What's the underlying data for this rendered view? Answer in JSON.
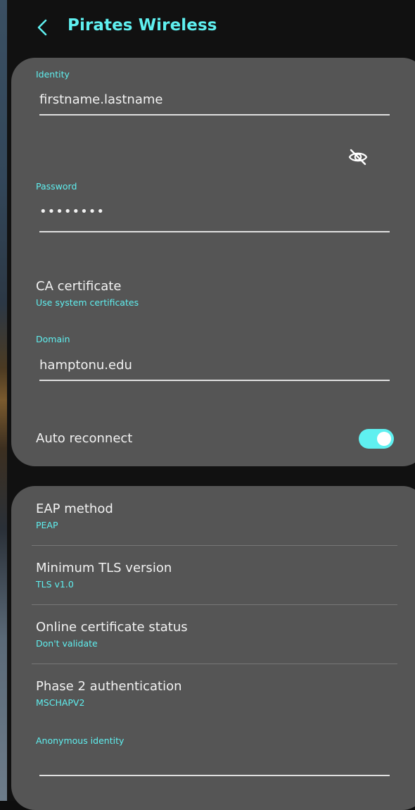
{
  "header": {
    "title": "Pirates Wireless",
    "back_icon": "chevron-left-icon"
  },
  "form": {
    "identity": {
      "label": "Identity",
      "value": "firstname.lastname"
    },
    "password": {
      "label": "Password",
      "value": "••••••••",
      "visibility_icon": "eye-off-icon"
    },
    "ca_certificate": {
      "title": "CA certificate",
      "value": "Use system certificates"
    },
    "domain": {
      "label": "Domain",
      "value": "hamptonu.edu"
    },
    "auto_reconnect": {
      "label": "Auto reconnect",
      "enabled": true
    }
  },
  "advanced": {
    "eap_method": {
      "title": "EAP method",
      "value": "PEAP"
    },
    "min_tls": {
      "title": "Minimum TLS version",
      "value": "TLS v1.0"
    },
    "ocsp": {
      "title": "Online certificate status",
      "value": "Don't validate"
    },
    "phase2": {
      "title": "Phase 2 authentication",
      "value": "MSCHAPV2"
    },
    "anonymous_identity": {
      "label": "Anonymous identity",
      "value": ""
    }
  },
  "colors": {
    "accent": "#5ff0f0",
    "card": "#555555",
    "text": "#f2f2f2",
    "background": "#111111"
  }
}
